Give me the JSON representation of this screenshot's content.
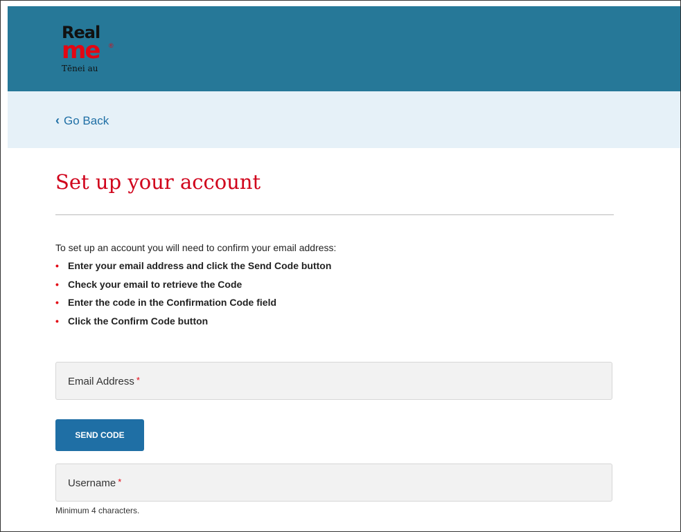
{
  "header": {
    "logo_real": "Real",
    "logo_me": "me",
    "logo_registered": "®",
    "logo_tagline": "Tēnei au",
    "background_color": "#267898"
  },
  "nav": {
    "chevron_icon": "chevron-left-icon",
    "chevron_glyph": "‹",
    "go_back_label": "Go Back"
  },
  "page": {
    "title": "Set up your account",
    "intro": "To set up an account you will need to confirm your email address:",
    "bullet_glyph": "•",
    "steps": [
      "Enter your email address and click the Send Code button",
      "Check your email to retrieve the Code",
      "Enter the code in the Confirmation Code field",
      "Click the Confirm Code button"
    ]
  },
  "form": {
    "email": {
      "label": "Email Address",
      "required_marker": "*",
      "value": ""
    },
    "send_code_label": "SEND CODE",
    "username": {
      "label": "Username",
      "required_marker": "*",
      "value": "",
      "hint": "Minimum 4 characters."
    }
  },
  "colors": {
    "accent_red": "#d0021b",
    "link_blue": "#1f6fa5",
    "back_bar": "#e6f1f8",
    "field_bg": "#f2f2f2"
  }
}
